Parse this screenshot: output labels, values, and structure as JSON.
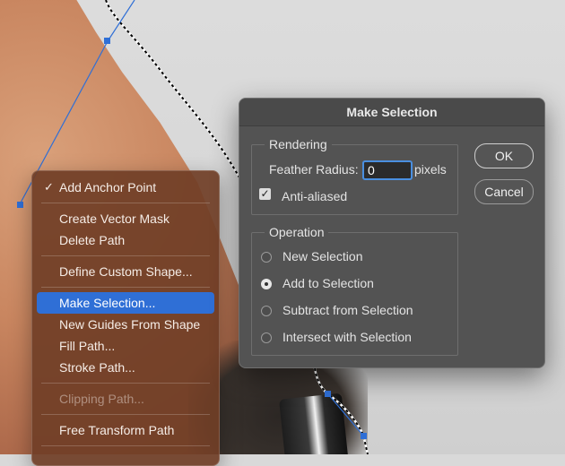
{
  "context_menu": {
    "items": [
      {
        "label": "Add Anchor Point",
        "checked": true
      },
      {
        "label": "Create Vector Mask"
      },
      {
        "label": "Delete Path"
      },
      {
        "label": "Define Custom Shape..."
      },
      {
        "label": "Make Selection...",
        "highlighted": true
      },
      {
        "label": "New Guides From Shape"
      },
      {
        "label": "Fill Path..."
      },
      {
        "label": "Stroke Path..."
      },
      {
        "label": "Clipping Path...",
        "disabled": true
      },
      {
        "label": "Free Transform Path"
      }
    ],
    "check_glyph": "✓",
    "highlight_color": "#2f6fd6"
  },
  "dialog": {
    "title": "Make Selection",
    "rendering": {
      "group_label": "Rendering",
      "feather_label": "Feather Radius:",
      "feather_value": "0",
      "feather_unit": "pixels",
      "antialias_label": "Anti-aliased",
      "antialias_checked": true
    },
    "operation": {
      "group_label": "Operation",
      "options": [
        {
          "label": "New Selection",
          "selected": false
        },
        {
          "label": "Add to Selection",
          "selected": true
        },
        {
          "label": "Subtract from Selection",
          "selected": false
        },
        {
          "label": "Intersect with Selection",
          "selected": false
        }
      ]
    },
    "buttons": {
      "ok": "OK",
      "cancel": "Cancel"
    }
  },
  "icons": {
    "checkbox": "checkmark-icon"
  },
  "colors": {
    "path_line": "#2f6fd6",
    "dialog_bg": "#535353"
  }
}
